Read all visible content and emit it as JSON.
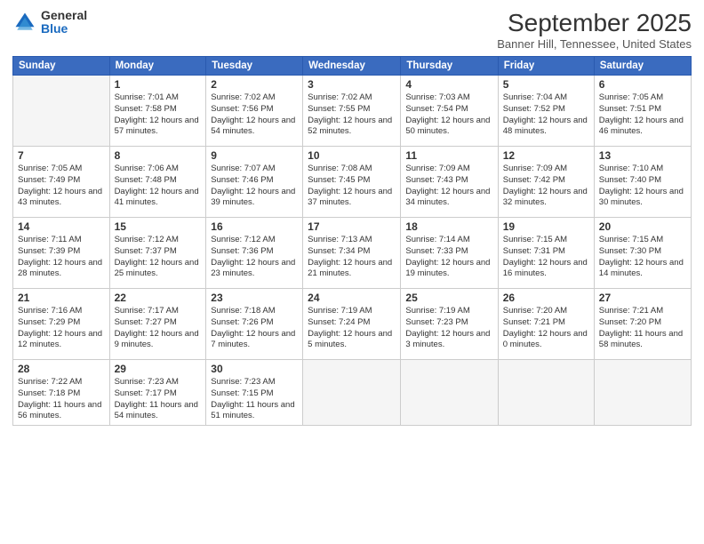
{
  "logo": {
    "general": "General",
    "blue": "Blue"
  },
  "title": "September 2025",
  "location": "Banner Hill, Tennessee, United States",
  "days_of_week": [
    "Sunday",
    "Monday",
    "Tuesday",
    "Wednesday",
    "Thursday",
    "Friday",
    "Saturday"
  ],
  "weeks": [
    [
      {
        "day": "",
        "info": ""
      },
      {
        "day": "1",
        "info": "Sunrise: 7:01 AM\nSunset: 7:58 PM\nDaylight: 12 hours\nand 57 minutes."
      },
      {
        "day": "2",
        "info": "Sunrise: 7:02 AM\nSunset: 7:56 PM\nDaylight: 12 hours\nand 54 minutes."
      },
      {
        "day": "3",
        "info": "Sunrise: 7:02 AM\nSunset: 7:55 PM\nDaylight: 12 hours\nand 52 minutes."
      },
      {
        "day": "4",
        "info": "Sunrise: 7:03 AM\nSunset: 7:54 PM\nDaylight: 12 hours\nand 50 minutes."
      },
      {
        "day": "5",
        "info": "Sunrise: 7:04 AM\nSunset: 7:52 PM\nDaylight: 12 hours\nand 48 minutes."
      },
      {
        "day": "6",
        "info": "Sunrise: 7:05 AM\nSunset: 7:51 PM\nDaylight: 12 hours\nand 46 minutes."
      }
    ],
    [
      {
        "day": "7",
        "info": "Sunrise: 7:05 AM\nSunset: 7:49 PM\nDaylight: 12 hours\nand 43 minutes."
      },
      {
        "day": "8",
        "info": "Sunrise: 7:06 AM\nSunset: 7:48 PM\nDaylight: 12 hours\nand 41 minutes."
      },
      {
        "day": "9",
        "info": "Sunrise: 7:07 AM\nSunset: 7:46 PM\nDaylight: 12 hours\nand 39 minutes."
      },
      {
        "day": "10",
        "info": "Sunrise: 7:08 AM\nSunset: 7:45 PM\nDaylight: 12 hours\nand 37 minutes."
      },
      {
        "day": "11",
        "info": "Sunrise: 7:09 AM\nSunset: 7:43 PM\nDaylight: 12 hours\nand 34 minutes."
      },
      {
        "day": "12",
        "info": "Sunrise: 7:09 AM\nSunset: 7:42 PM\nDaylight: 12 hours\nand 32 minutes."
      },
      {
        "day": "13",
        "info": "Sunrise: 7:10 AM\nSunset: 7:40 PM\nDaylight: 12 hours\nand 30 minutes."
      }
    ],
    [
      {
        "day": "14",
        "info": "Sunrise: 7:11 AM\nSunset: 7:39 PM\nDaylight: 12 hours\nand 28 minutes."
      },
      {
        "day": "15",
        "info": "Sunrise: 7:12 AM\nSunset: 7:37 PM\nDaylight: 12 hours\nand 25 minutes."
      },
      {
        "day": "16",
        "info": "Sunrise: 7:12 AM\nSunset: 7:36 PM\nDaylight: 12 hours\nand 23 minutes."
      },
      {
        "day": "17",
        "info": "Sunrise: 7:13 AM\nSunset: 7:34 PM\nDaylight: 12 hours\nand 21 minutes."
      },
      {
        "day": "18",
        "info": "Sunrise: 7:14 AM\nSunset: 7:33 PM\nDaylight: 12 hours\nand 19 minutes."
      },
      {
        "day": "19",
        "info": "Sunrise: 7:15 AM\nSunset: 7:31 PM\nDaylight: 12 hours\nand 16 minutes."
      },
      {
        "day": "20",
        "info": "Sunrise: 7:15 AM\nSunset: 7:30 PM\nDaylight: 12 hours\nand 14 minutes."
      }
    ],
    [
      {
        "day": "21",
        "info": "Sunrise: 7:16 AM\nSunset: 7:29 PM\nDaylight: 12 hours\nand 12 minutes."
      },
      {
        "day": "22",
        "info": "Sunrise: 7:17 AM\nSunset: 7:27 PM\nDaylight: 12 hours\nand 9 minutes."
      },
      {
        "day": "23",
        "info": "Sunrise: 7:18 AM\nSunset: 7:26 PM\nDaylight: 12 hours\nand 7 minutes."
      },
      {
        "day": "24",
        "info": "Sunrise: 7:19 AM\nSunset: 7:24 PM\nDaylight: 12 hours\nand 5 minutes."
      },
      {
        "day": "25",
        "info": "Sunrise: 7:19 AM\nSunset: 7:23 PM\nDaylight: 12 hours\nand 3 minutes."
      },
      {
        "day": "26",
        "info": "Sunrise: 7:20 AM\nSunset: 7:21 PM\nDaylight: 12 hours\nand 0 minutes."
      },
      {
        "day": "27",
        "info": "Sunrise: 7:21 AM\nSunset: 7:20 PM\nDaylight: 11 hours\nand 58 minutes."
      }
    ],
    [
      {
        "day": "28",
        "info": "Sunrise: 7:22 AM\nSunset: 7:18 PM\nDaylight: 11 hours\nand 56 minutes."
      },
      {
        "day": "29",
        "info": "Sunrise: 7:23 AM\nSunset: 7:17 PM\nDaylight: 11 hours\nand 54 minutes."
      },
      {
        "day": "30",
        "info": "Sunrise: 7:23 AM\nSunset: 7:15 PM\nDaylight: 11 hours\nand 51 minutes."
      },
      {
        "day": "",
        "info": ""
      },
      {
        "day": "",
        "info": ""
      },
      {
        "day": "",
        "info": ""
      },
      {
        "day": "",
        "info": ""
      }
    ]
  ]
}
